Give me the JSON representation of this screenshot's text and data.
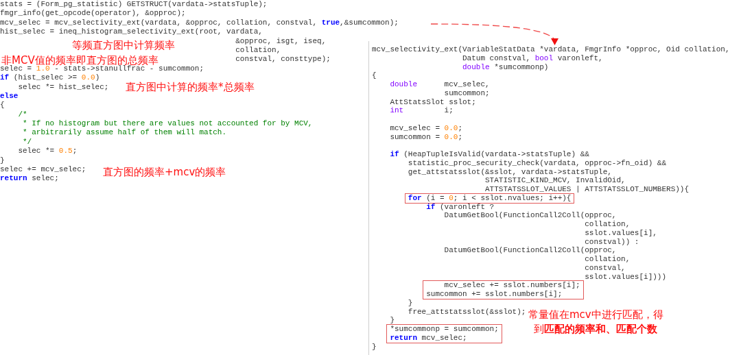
{
  "code_panes": [
    {
      "lines": [
        {
          "kind": "line",
          "tokens": [
            {
              "kind": "text",
              "text": "stats = (Form_pg_statistic) GETSTRUCT(vardata->statsTuple);"
            }
          ]
        },
        {
          "kind": "line",
          "tokens": [
            {
              "kind": "text",
              "text": "fmgr_info(get_opcode(operator), &opproc);"
            }
          ]
        },
        {
          "kind": "line",
          "tokens": [
            {
              "kind": "text",
              "text": "mcv_selec = mcv_selectivity_ext(vardata, &opproc, collation, constval, "
            },
            {
              "kind": "keyword",
              "text": "true"
            },
            {
              "kind": "text",
              "text": ",&sumcommon);"
            }
          ]
        },
        {
          "kind": "line",
          "tokens": [
            {
              "kind": "text",
              "text": "hist_selec = ineq_histogram_selectivity_ext(root, vardata,"
            }
          ]
        },
        {
          "kind": "line",
          "tokens": [
            {
              "kind": "text",
              "text": "                                                    &opproc, isgt, iseq,"
            }
          ]
        },
        {
          "kind": "line",
          "tokens": [
            {
              "kind": "text",
              "text": "                                                    collation,"
            }
          ]
        },
        {
          "kind": "line",
          "tokens": [
            {
              "kind": "text",
              "text": "                                                    constval, consttype);"
            }
          ]
        },
        {
          "kind": "line",
          "tokens": [
            {
              "kind": "text",
              "text": "selec = "
            },
            {
              "kind": "number",
              "text": "1.0"
            },
            {
              "kind": "text",
              "text": " - stats->stanullfrac - sumcommon;"
            }
          ]
        },
        {
          "kind": "line",
          "tokens": [
            {
              "kind": "keyword",
              "text": "if"
            },
            {
              "kind": "text",
              "text": " (hist_selec >= "
            },
            {
              "kind": "number",
              "text": "0.0"
            },
            {
              "kind": "text",
              "text": ")"
            }
          ]
        },
        {
          "kind": "line",
          "tokens": [
            {
              "kind": "text",
              "text": "    selec *= hist_selec;"
            }
          ]
        },
        {
          "kind": "line",
          "tokens": [
            {
              "kind": "keyword",
              "text": "else"
            }
          ]
        },
        {
          "kind": "line",
          "tokens": [
            {
              "kind": "text",
              "text": "{"
            }
          ]
        },
        {
          "kind": "line",
          "tokens": [
            {
              "kind": "comment",
              "text": "    /*"
            }
          ]
        },
        {
          "kind": "line",
          "tokens": [
            {
              "kind": "comment",
              "text": "     * If no histogram but there are values not accounted for by MCV,"
            }
          ]
        },
        {
          "kind": "line",
          "tokens": [
            {
              "kind": "comment",
              "text": "     * arbitrarily assume half of them will match."
            }
          ]
        },
        {
          "kind": "line",
          "tokens": [
            {
              "kind": "comment",
              "text": "     */"
            }
          ]
        },
        {
          "kind": "line",
          "tokens": [
            {
              "kind": "text",
              "text": "    selec *= "
            },
            {
              "kind": "number",
              "text": "0.5"
            },
            {
              "kind": "text",
              "text": ";"
            }
          ]
        },
        {
          "kind": "line",
          "tokens": [
            {
              "kind": "text",
              "text": "}"
            }
          ]
        },
        {
          "kind": "line",
          "tokens": [
            {
              "kind": "text",
              "text": "selec += mcv_selec;"
            }
          ]
        },
        {
          "kind": "line",
          "tokens": [
            {
              "kind": "keyword",
              "text": "return"
            },
            {
              "kind": "text",
              "text": " selec;"
            }
          ]
        }
      ]
    },
    {
      "lines": [
        {
          "kind": "line",
          "tokens": [
            {
              "kind": "text",
              "text": "mcv_selectivity_ext(VariableStatData *vardata, FmgrInfo *opproc, Oid collation,"
            }
          ]
        },
        {
          "kind": "line",
          "tokens": [
            {
              "kind": "text",
              "text": "                    Datum constval, "
            },
            {
              "kind": "type",
              "text": "bool"
            },
            {
              "kind": "text",
              "text": " varonleft,"
            }
          ]
        },
        {
          "kind": "line",
          "tokens": [
            {
              "kind": "type",
              "text": "                    double"
            },
            {
              "kind": "text",
              "text": " *sumcommonp)"
            }
          ]
        },
        {
          "kind": "line",
          "tokens": [
            {
              "kind": "text",
              "text": "{"
            }
          ]
        },
        {
          "kind": "line",
          "tokens": [
            {
              "kind": "type",
              "text": "    double"
            },
            {
              "kind": "text",
              "text": "      mcv_selec,"
            }
          ]
        },
        {
          "kind": "line",
          "tokens": [
            {
              "kind": "text",
              "text": "                sumcommon;"
            }
          ]
        },
        {
          "kind": "line",
          "tokens": [
            {
              "kind": "text",
              "text": "    AttStatsSlot sslot;"
            }
          ]
        },
        {
          "kind": "line",
          "tokens": [
            {
              "kind": "type",
              "text": "    int"
            },
            {
              "kind": "text",
              "text": "         i;"
            }
          ]
        },
        {
          "kind": "blank"
        },
        {
          "kind": "line",
          "tokens": [
            {
              "kind": "text",
              "text": "    mcv_selec = "
            },
            {
              "kind": "number",
              "text": "0.0"
            },
            {
              "kind": "text",
              "text": ";"
            }
          ]
        },
        {
          "kind": "line",
          "tokens": [
            {
              "kind": "text",
              "text": "    sumcommon = "
            },
            {
              "kind": "number",
              "text": "0.0"
            },
            {
              "kind": "text",
              "text": ";"
            }
          ]
        },
        {
          "kind": "blank"
        },
        {
          "kind": "line",
          "tokens": [
            {
              "kind": "keyword",
              "text": "    if"
            },
            {
              "kind": "text",
              "text": " (HeapTupleIsValid(vardata->statsTuple) &&"
            }
          ]
        },
        {
          "kind": "line",
          "tokens": [
            {
              "kind": "text",
              "text": "        statistic_proc_security_check(vardata, opproc->fn_oid) &&"
            }
          ]
        },
        {
          "kind": "line",
          "tokens": [
            {
              "kind": "text",
              "text": "        get_attstatsslot(&sslot, vardata->statsTuple,"
            }
          ]
        },
        {
          "kind": "line",
          "tokens": [
            {
              "kind": "text",
              "text": "                         STATISTIC_KIND_MCV, InvalidOid,"
            }
          ]
        },
        {
          "kind": "line",
          "tokens": [
            {
              "kind": "text",
              "text": "                         ATTSTATSSLOT_VALUES | ATTSTATSSLOT_NUMBERS)){"
            }
          ]
        },
        {
          "kind": "boxed",
          "lines": [
            {
              "kind": "line",
              "tokens": [
                {
                  "kind": "keyword",
                  "text": "        for"
                },
                {
                  "kind": "text",
                  "text": " (i = "
                },
                {
                  "kind": "number",
                  "text": "0"
                },
                {
                  "kind": "text",
                  "text": "; i < sslot.nvalues; i++){"
                }
              ]
            }
          ]
        },
        {
          "kind": "line",
          "tokens": [
            {
              "kind": "keyword",
              "text": "            if"
            },
            {
              "kind": "text",
              "text": " (varonleft ?"
            }
          ]
        },
        {
          "kind": "line",
          "tokens": [
            {
              "kind": "text",
              "text": "                DatumGetBool(FunctionCall2Coll(opproc,"
            }
          ]
        },
        {
          "kind": "line",
          "tokens": [
            {
              "kind": "text",
              "text": "                                               collation,"
            }
          ]
        },
        {
          "kind": "line",
          "tokens": [
            {
              "kind": "text",
              "text": "                                               sslot.values[i],"
            }
          ]
        },
        {
          "kind": "line",
          "tokens": [
            {
              "kind": "text",
              "text": "                                               constval)) :"
            }
          ]
        },
        {
          "kind": "line",
          "tokens": [
            {
              "kind": "text",
              "text": "                DatumGetBool(FunctionCall2Coll(opproc,"
            }
          ]
        },
        {
          "kind": "line",
          "tokens": [
            {
              "kind": "text",
              "text": "                                               collation,"
            }
          ]
        },
        {
          "kind": "line",
          "tokens": [
            {
              "kind": "text",
              "text": "                                               constval,"
            }
          ]
        },
        {
          "kind": "line",
          "tokens": [
            {
              "kind": "text",
              "text": "                                               sslot.values[i])))"
            }
          ]
        },
        {
          "kind": "boxed",
          "lines": [
            {
              "kind": "line",
              "tokens": [
                {
                  "kind": "text",
                  "text": "                mcv_selec += sslot.numbers[i];"
                }
              ]
            },
            {
              "kind": "line",
              "tokens": [
                {
                  "kind": "text",
                  "text": "            sumcommon += sslot.numbers[i];"
                }
              ]
            }
          ]
        },
        {
          "kind": "line",
          "tokens": [
            {
              "kind": "text",
              "text": "        }"
            }
          ]
        },
        {
          "kind": "line",
          "tokens": [
            {
              "kind": "text",
              "text": "        free_attstatsslot(&sslot);"
            }
          ]
        },
        {
          "kind": "line",
          "tokens": [
            {
              "kind": "text",
              "text": "    }"
            }
          ]
        },
        {
          "kind": "boxed",
          "lines": [
            {
              "kind": "line",
              "tokens": [
                {
                  "kind": "text",
                  "text": "    *sumcommonp = sumcommon;"
                }
              ]
            },
            {
              "kind": "line",
              "tokens": [
                {
                  "kind": "keyword",
                  "text": "    return"
                },
                {
                  "kind": "text",
                  "text": " mcv_selec;"
                }
              ]
            }
          ]
        },
        {
          "kind": "line",
          "tokens": [
            {
              "kind": "text",
              "text": "}"
            }
          ]
        }
      ]
    }
  ],
  "annotations": [
    {
      "lines": [
        "等频直方图中计算频率"
      ]
    },
    {
      "lines": [
        "非MCV值的频率即直方图的总频率"
      ]
    },
    {
      "lines": [
        "直方图中计算的频率*总频率"
      ]
    },
    {
      "lines": [
        "直方图的频率+mcv的频率"
      ]
    },
    {
      "lines": [
        "常量值在mcv中进行匹配，得",
        "到**匹配的频率和、匹配个数**"
      ]
    }
  ]
}
